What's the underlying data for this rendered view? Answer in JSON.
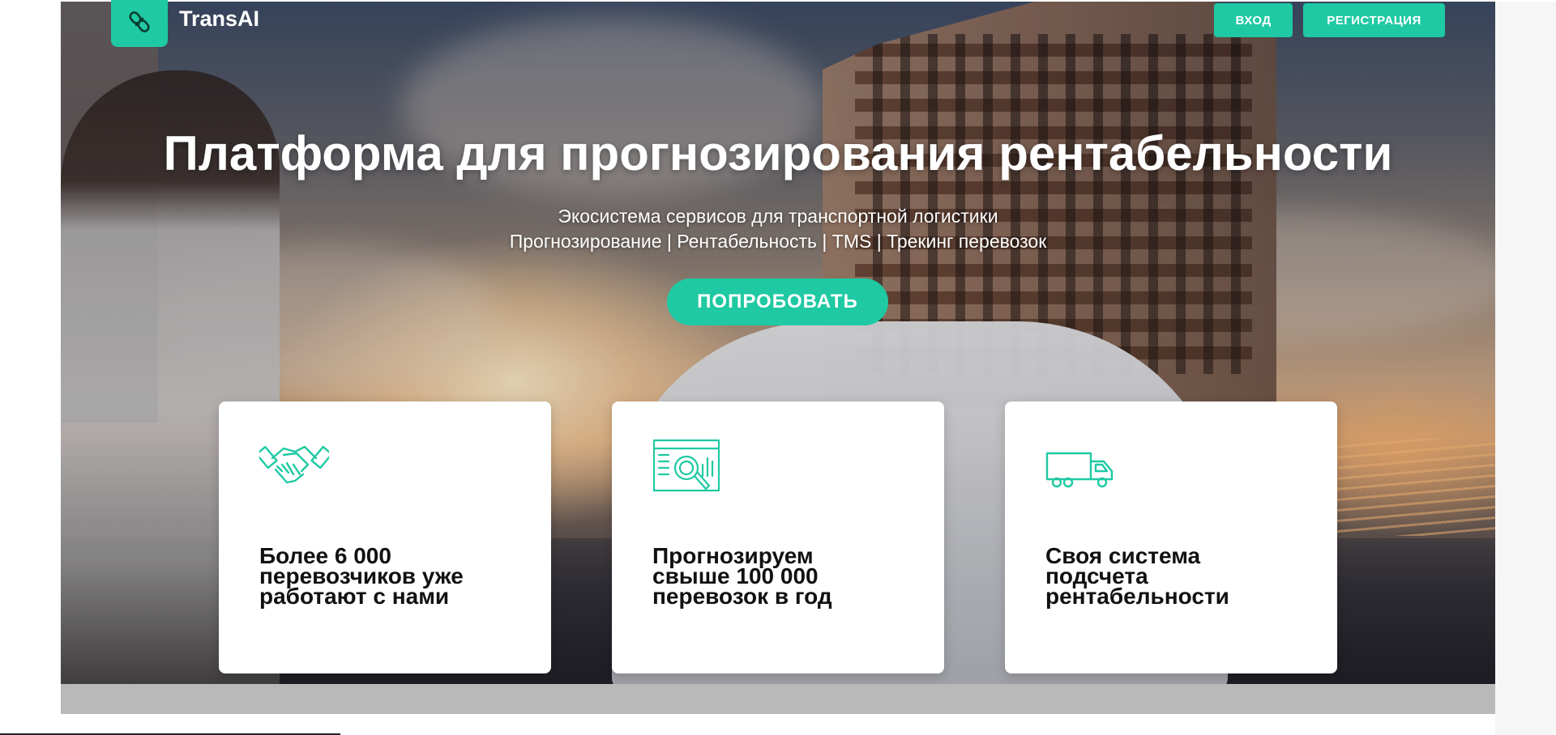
{
  "brand": {
    "name": "TransAI",
    "icon": "link-chain-icon",
    "accent_color": "#1fc9a3"
  },
  "nav": {
    "login_label": "ВХОД",
    "register_label": "РЕГИСТРАЦИЯ"
  },
  "hero": {
    "title": "Платформа для прогнозирования рентабельности",
    "subtitle_line1": "Экосистема сервисов для транспортной логистики",
    "subtitle_line2": "Прогнозирование | Рентабельность | TMS | Трекинг перевозок",
    "cta_label": "ПОПРОБОВАТЬ"
  },
  "features": [
    {
      "icon": "handshake-icon",
      "text": "Более 6 000\nперевозчиков уже\nработают с нами"
    },
    {
      "icon": "analytics-magnifier-icon",
      "text": "Прогнозируем\nсвыше 100 000\nперевозок в год"
    },
    {
      "icon": "truck-icon",
      "text": "Своя система\nподсчета\nрентабельности"
    }
  ]
}
